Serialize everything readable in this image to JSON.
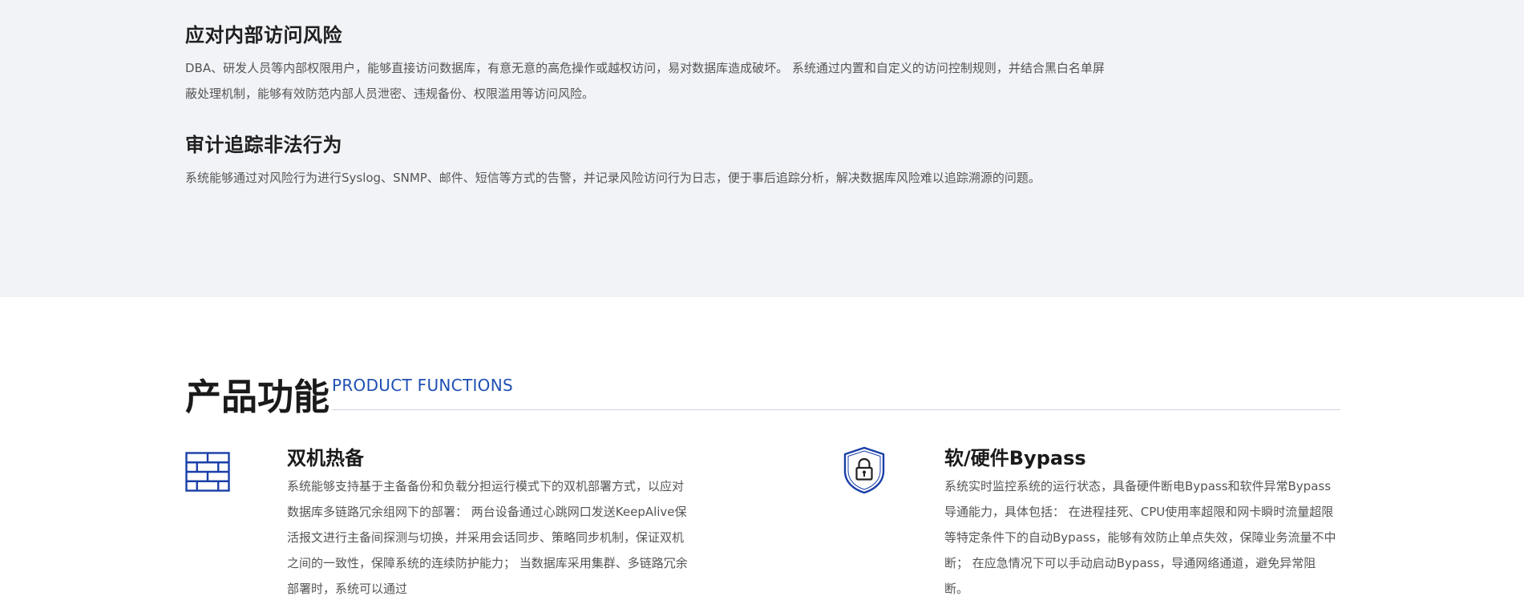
{
  "risk_items": [
    {
      "title": "应对内部访问风险",
      "description": "DBA、研发人员等内部权限用户，能够直接访问数据库，有意无意的高危操作或越权访问，易对数据库造成破坏。 系统通过内置和自定义的访问控制规则，并结合黑白名单屏蔽处理机制，能够有效防范内部人员泄密、违规备份、权限滥用等访问风险。"
    },
    {
      "title": "审计追踪非法行为",
      "description": "系统能够通过对风险行为进行Syslog、SNMP、邮件、短信等方式的告警，并记录风险访问行为日志，便于事后追踪分析，解决数据库风险难以追踪溯源的问题。"
    }
  ],
  "functions": {
    "heading": "产品功能",
    "subheading": "PRODUCT FUNCTIONS",
    "items": [
      {
        "title": "双机热备",
        "icon": "brick-wall-icon",
        "description": "系统能够支持基于主备备份和负载分担运行模式下的双机部署方式，以应对数据库多链路冗余组网下的部署： 两台设备通过心跳网口发送KeepAlive保活报文进行主备间探测与切换，并采用会话同步、策略同步机制，保证双机之间的一致性，保障系统的连续防护能力； 当数据库采用集群、多链路冗余部署时，系统可以通过"
      },
      {
        "title": "软/硬件Bypass",
        "icon": "shield-lock-icon",
        "description": "系统实时监控系统的运行状态，具备硬件断电Bypass和软件异常Bypass导通能力，具体包括： 在进程挂死、CPU使用率超限和网卡瞬时流量超限等特定条件下的自动Bypass，能够有效防止单点失效，保障业务流量不中断； 在应急情况下可以手动启动Bypass，导通网络通道，避免异常阻断。"
      }
    ]
  },
  "colors": {
    "accent": "#1f4fb3",
    "icon_blue": "#1a3fa8",
    "risk_background": "#f2f3f7"
  }
}
